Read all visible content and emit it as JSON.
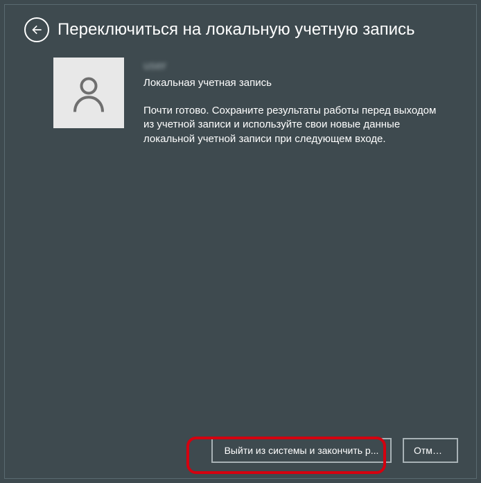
{
  "header": {
    "title": "Переключиться на локальную учетную запись"
  },
  "user": {
    "name_obscured": "user",
    "account_type": "Локальная учетная запись",
    "description": "Почти готово. Сохраните результаты работы перед выходом из учетной записи и используйте свои новые данные локальной учетной записи при следующем входе."
  },
  "buttons": {
    "primary": "Выйти из системы и закончить р...",
    "cancel": "Отмена"
  },
  "colors": {
    "background": "#3e4a4f",
    "border": "#5a6a70",
    "highlight": "#d4000f",
    "avatar_bg": "#e8e8e8"
  }
}
